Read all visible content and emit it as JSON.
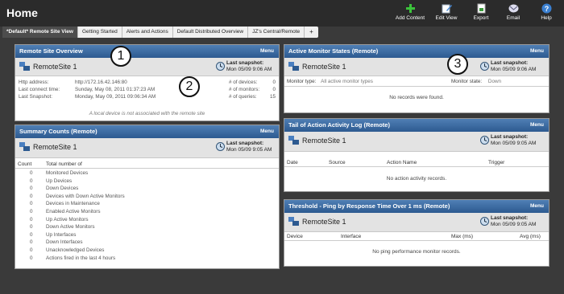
{
  "app": {
    "title": "Home"
  },
  "toolbar": [
    {
      "label": "Add Content",
      "icon": "plus-icon"
    },
    {
      "label": "Edit View",
      "icon": "edit-icon"
    },
    {
      "label": "Export",
      "icon": "export-icon"
    },
    {
      "label": "Email",
      "icon": "email-icon"
    },
    {
      "label": "Help",
      "icon": "help-icon"
    }
  ],
  "tabs": [
    {
      "label": "*Default* Remote Site View",
      "active": true
    },
    {
      "label": "Getting Started"
    },
    {
      "label": "Alerts and Actions"
    },
    {
      "label": "Default Distributed Overview"
    },
    {
      "label": "JZ's Central/Remote"
    },
    {
      "label": "+"
    }
  ],
  "overview": {
    "title": "Remote Site Overview",
    "menu": "Menu",
    "site": "RemoteSite 1",
    "snap_label": "Last snapshot:",
    "snap_time": "Mon 05/09 9:06 AM",
    "http_label": "Http address:",
    "http_value": "http://172.16.42.146:80",
    "connect_label": "Last connect time:",
    "connect_value": "Sunday, May 08, 2011 01:37:23 AM",
    "snapshot_label": "Last Snapshot:",
    "snapshot_value": "Monday, May 09, 2011 09:06:34 AM",
    "devices_label": "# of devices:",
    "devices_value": "0",
    "monitors_label": "# of monitors:",
    "monitors_value": "0",
    "queries_label": "# of queries:",
    "queries_value": "15",
    "note": "A local device is not associated with the remote site"
  },
  "summary": {
    "title": "Summary Counts (Remote)",
    "menu": "Menu",
    "site": "RemoteSite 1",
    "snap_label": "Last snapshot:",
    "snap_time": "Mon 05/09 9:05 AM",
    "col_count": "Count",
    "col_total": "Total number of",
    "rows": [
      {
        "count": "0",
        "label": "Monitored Devices"
      },
      {
        "count": "0",
        "label": "Up Devices"
      },
      {
        "count": "0",
        "label": "Down Devices"
      },
      {
        "count": "0",
        "label": "Devices with Down Active Monitors"
      },
      {
        "count": "0",
        "label": "Devices in Maintenance"
      },
      {
        "count": "0",
        "label": "Enabled Active Monitors"
      },
      {
        "count": "0",
        "label": "Up Active Monitors"
      },
      {
        "count": "0",
        "label": "Down Active Monitors"
      },
      {
        "count": "0",
        "label": "Up Interfaces"
      },
      {
        "count": "0",
        "label": "Down Interfaces"
      },
      {
        "count": "0",
        "label": "Unacknowledged Devices"
      },
      {
        "count": "0",
        "label": "Actions fired in the last 4 hours"
      }
    ]
  },
  "active_monitor": {
    "title": "Active Monitor States (Remote)",
    "menu": "Menu",
    "site": "RemoteSite 1",
    "snap_label": "Last snapshot:",
    "snap_time": "Mon 05/09 9:06 AM",
    "type_label": "Monitor type:",
    "type_value": "All active monitor types",
    "state_label": "Monitor state:",
    "state_value": "Down",
    "empty": "No records were found."
  },
  "action_log": {
    "title": "Tail of Action Activity Log (Remote)",
    "menu": "Menu",
    "site": "RemoteSite 1",
    "snap_label": "Last snapshot:",
    "snap_time": "Mon 05/09 9:05 AM",
    "cols": [
      "Date",
      "Source",
      "Action Name",
      "Trigger"
    ],
    "empty": "No action activity records."
  },
  "threshold": {
    "title": "Threshold - Ping by Response Time Over 1 ms (Remote)",
    "menu": "Menu",
    "site": "RemoteSite 1",
    "snap_label": "Last snapshot:",
    "snap_time": "Mon 05/09 9:05 AM",
    "cols": [
      "Device",
      "Interface",
      "Max (ms)",
      "Avg (ms)"
    ],
    "empty": "No ping performance monitor records."
  },
  "callouts": [
    "1",
    "2",
    "3"
  ]
}
